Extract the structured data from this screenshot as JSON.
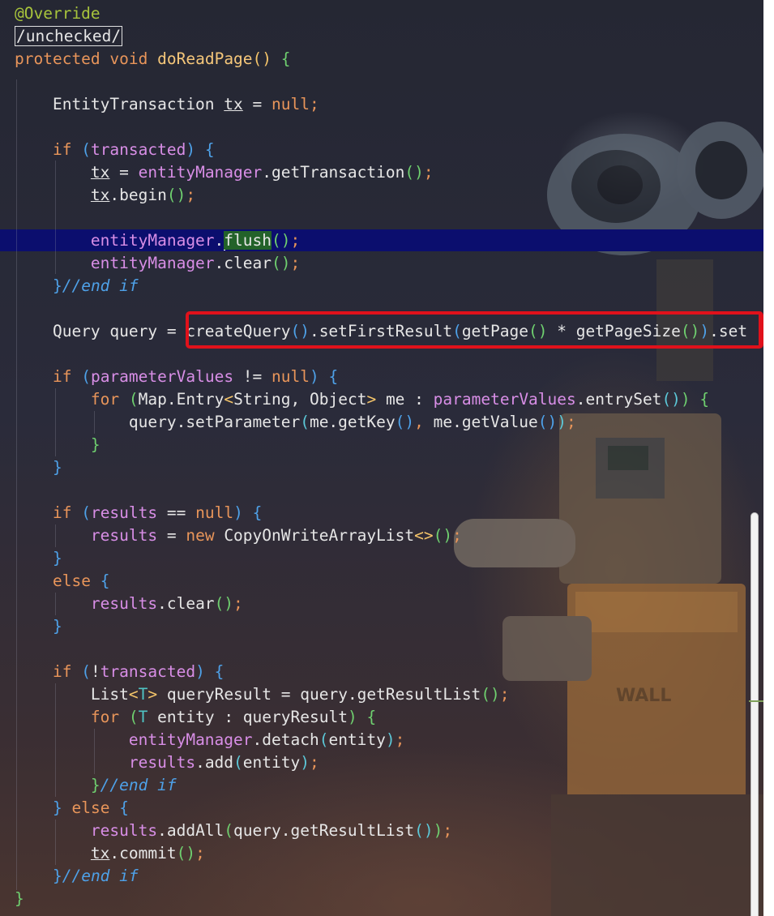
{
  "editor": {
    "lines": [
      {
        "parts": [
          [
            "ann",
            "@Override"
          ]
        ]
      },
      {
        "parts": [
          [
            "box",
            "/unchecked/"
          ]
        ]
      },
      {
        "parts": [
          [
            "k",
            "protected"
          ],
          [
            "",
            " "
          ],
          [
            "k",
            "void"
          ],
          [
            "",
            " "
          ],
          [
            "fn",
            "doReadPage"
          ],
          [
            "p1",
            "()"
          ],
          [
            "",
            " "
          ],
          [
            "p3",
            "{"
          ]
        ]
      },
      {
        "parts": []
      },
      {
        "parts": [
          [
            "",
            "    EntityTransaction "
          ],
          [
            "u",
            "tx"
          ],
          [
            "",
            " = "
          ],
          [
            "k",
            "null"
          ],
          [
            "k",
            ";"
          ]
        ]
      },
      {
        "parts": []
      },
      {
        "parts": [
          [
            "",
            "    "
          ],
          [
            "k",
            "if"
          ],
          [
            "",
            " "
          ],
          [
            "p2",
            "("
          ],
          [
            "pur",
            "transacted"
          ],
          [
            "p2",
            ")"
          ],
          [
            "",
            " "
          ],
          [
            "p2",
            "{"
          ]
        ]
      },
      {
        "parts": [
          [
            "",
            "        "
          ],
          [
            "u",
            "tx"
          ],
          [
            "",
            " = "
          ],
          [
            "pur",
            "entityManager"
          ],
          [
            "",
            ".getTransaction"
          ],
          [
            "p3",
            "()"
          ],
          [
            "k",
            ";"
          ]
        ]
      },
      {
        "parts": [
          [
            "",
            "        "
          ],
          [
            "u",
            "tx"
          ],
          [
            "",
            ".begin"
          ],
          [
            "p3",
            "()"
          ],
          [
            "k",
            ";"
          ]
        ]
      },
      {
        "parts": []
      },
      {
        "parts": [
          [
            "",
            "        "
          ],
          [
            "pur",
            "entityManager"
          ],
          [
            "",
            "."
          ],
          [
            "caret",
            ""
          ],
          [
            "match",
            "flush"
          ],
          [
            "p3",
            "()"
          ],
          [
            "k",
            ";"
          ]
        ]
      },
      {
        "parts": [
          [
            "",
            "        "
          ],
          [
            "pur",
            "entityManager"
          ],
          [
            "",
            ".clear"
          ],
          [
            "p3",
            "()"
          ],
          [
            "k",
            ";"
          ]
        ]
      },
      {
        "parts": [
          [
            "",
            "    "
          ],
          [
            "p2",
            "}"
          ],
          [
            "cm",
            "//end if"
          ]
        ]
      },
      {
        "parts": []
      },
      {
        "parts": [
          [
            "",
            "    Query query = createQuery"
          ],
          [
            "p2",
            "()"
          ],
          [
            "",
            ".setFirstResult"
          ],
          [
            "p2",
            "("
          ],
          [
            "",
            "getPage"
          ],
          [
            "p3",
            "()"
          ],
          [
            "",
            " * getPageSize"
          ],
          [
            "p3",
            "()"
          ],
          [
            "p2",
            ")"
          ],
          [
            "",
            ".set"
          ]
        ]
      },
      {
        "parts": []
      },
      {
        "parts": [
          [
            "",
            "    "
          ],
          [
            "k",
            "if"
          ],
          [
            "",
            " "
          ],
          [
            "p2",
            "("
          ],
          [
            "pur",
            "parameterValues"
          ],
          [
            "",
            " != "
          ],
          [
            "k",
            "null"
          ],
          [
            "p2",
            ")"
          ],
          [
            "",
            " "
          ],
          [
            "p2",
            "{"
          ]
        ]
      },
      {
        "parts": [
          [
            "",
            "        "
          ],
          [
            "k",
            "for"
          ],
          [
            "",
            " "
          ],
          [
            "p3",
            "("
          ],
          [
            "",
            "Map.Entry"
          ],
          [
            "p1",
            "<"
          ],
          [
            "",
            "String, Object"
          ],
          [
            "p1",
            ">"
          ],
          [
            "",
            " me : "
          ],
          [
            "pur",
            "parameterValues"
          ],
          [
            "",
            ".entrySet"
          ],
          [
            "p4",
            "()"
          ],
          [
            "p3",
            ")"
          ],
          [
            "",
            " "
          ],
          [
            "p3",
            "{"
          ]
        ]
      },
      {
        "parts": [
          [
            "",
            "            query.setParameter"
          ],
          [
            "p4",
            "("
          ],
          [
            "",
            "me.getKey"
          ],
          [
            "p2",
            "()"
          ],
          [
            "k",
            ","
          ],
          [
            "",
            " me.getValue"
          ],
          [
            "p2",
            "()"
          ],
          [
            "p4",
            ")"
          ],
          [
            "k",
            ";"
          ]
        ]
      },
      {
        "parts": [
          [
            "",
            "        "
          ],
          [
            "p3",
            "}"
          ]
        ]
      },
      {
        "parts": [
          [
            "",
            "    "
          ],
          [
            "p2",
            "}"
          ]
        ]
      },
      {
        "parts": []
      },
      {
        "parts": [
          [
            "",
            "    "
          ],
          [
            "k",
            "if"
          ],
          [
            "",
            " "
          ],
          [
            "p2",
            "("
          ],
          [
            "pur",
            "results"
          ],
          [
            "",
            " == "
          ],
          [
            "k",
            "null"
          ],
          [
            "p2",
            ")"
          ],
          [
            "",
            " "
          ],
          [
            "p2",
            "{"
          ]
        ]
      },
      {
        "parts": [
          [
            "",
            "        "
          ],
          [
            "pur",
            "results"
          ],
          [
            "",
            " = "
          ],
          [
            "k",
            "new"
          ],
          [
            "",
            " CopyOnWriteArrayList"
          ],
          [
            "p1",
            "<>"
          ],
          [
            "p3",
            "()"
          ],
          [
            "k",
            ";"
          ]
        ]
      },
      {
        "parts": [
          [
            "",
            "    "
          ],
          [
            "p2",
            "}"
          ]
        ]
      },
      {
        "parts": [
          [
            "",
            "    "
          ],
          [
            "k",
            "else"
          ],
          [
            "",
            " "
          ],
          [
            "p2",
            "{"
          ]
        ]
      },
      {
        "parts": [
          [
            "",
            "        "
          ],
          [
            "pur",
            "results"
          ],
          [
            "",
            ".clear"
          ],
          [
            "p3",
            "()"
          ],
          [
            "k",
            ";"
          ]
        ]
      },
      {
        "parts": [
          [
            "",
            "    "
          ],
          [
            "p2",
            "}"
          ]
        ]
      },
      {
        "parts": []
      },
      {
        "parts": [
          [
            "",
            "    "
          ],
          [
            "k",
            "if"
          ],
          [
            "",
            " "
          ],
          [
            "p2",
            "("
          ],
          [
            "",
            "!"
          ],
          [
            "pur",
            "transacted"
          ],
          [
            "p2",
            ")"
          ],
          [
            "",
            " "
          ],
          [
            "p2",
            "{"
          ]
        ]
      },
      {
        "parts": [
          [
            "",
            "        List"
          ],
          [
            "p1",
            "<"
          ],
          [
            "t",
            "T"
          ],
          [
            "p1",
            ">"
          ],
          [
            "",
            " queryResult = query.getResultList"
          ],
          [
            "p3",
            "()"
          ],
          [
            "k",
            ";"
          ]
        ]
      },
      {
        "parts": [
          [
            "",
            "        "
          ],
          [
            "k",
            "for"
          ],
          [
            "",
            " "
          ],
          [
            "p3",
            "("
          ],
          [
            "t",
            "T"
          ],
          [
            "",
            " entity : queryResult"
          ],
          [
            "p3",
            ")"
          ],
          [
            "",
            " "
          ],
          [
            "p3",
            "{"
          ]
        ]
      },
      {
        "parts": [
          [
            "",
            "            "
          ],
          [
            "pur",
            "entityManager"
          ],
          [
            "",
            ".detach"
          ],
          [
            "p4",
            "("
          ],
          [
            "",
            "entity"
          ],
          [
            "p4",
            ")"
          ],
          [
            "k",
            ";"
          ]
        ]
      },
      {
        "parts": [
          [
            "",
            "            "
          ],
          [
            "pur",
            "results"
          ],
          [
            "",
            ".add"
          ],
          [
            "p4",
            "("
          ],
          [
            "",
            "entity"
          ],
          [
            "p4",
            ")"
          ],
          [
            "k",
            ";"
          ]
        ]
      },
      {
        "parts": [
          [
            "",
            "        "
          ],
          [
            "p3",
            "}"
          ],
          [
            "cm",
            "//end if"
          ]
        ]
      },
      {
        "parts": [
          [
            "",
            "    "
          ],
          [
            "p2",
            "}"
          ],
          [
            "",
            " "
          ],
          [
            "k",
            "else"
          ],
          [
            "",
            " "
          ],
          [
            "p2",
            "{"
          ]
        ]
      },
      {
        "parts": [
          [
            "",
            "        "
          ],
          [
            "pur",
            "results"
          ],
          [
            "",
            ".addAll"
          ],
          [
            "p3",
            "("
          ],
          [
            "",
            "query.getResultList"
          ],
          [
            "p4",
            "()"
          ],
          [
            "p3",
            ")"
          ],
          [
            "k",
            ";"
          ]
        ]
      },
      {
        "parts": [
          [
            "",
            "        "
          ],
          [
            "u",
            "tx"
          ],
          [
            "",
            ".commit"
          ],
          [
            "p3",
            "()"
          ],
          [
            "k",
            ";"
          ]
        ]
      },
      {
        "parts": [
          [
            "",
            "    "
          ],
          [
            "p2",
            "}"
          ],
          [
            "cm",
            "//end if"
          ]
        ]
      },
      {
        "parts": [
          [
            "p3",
            "}"
          ]
        ]
      }
    ],
    "highlighted_query_line": 15
  }
}
